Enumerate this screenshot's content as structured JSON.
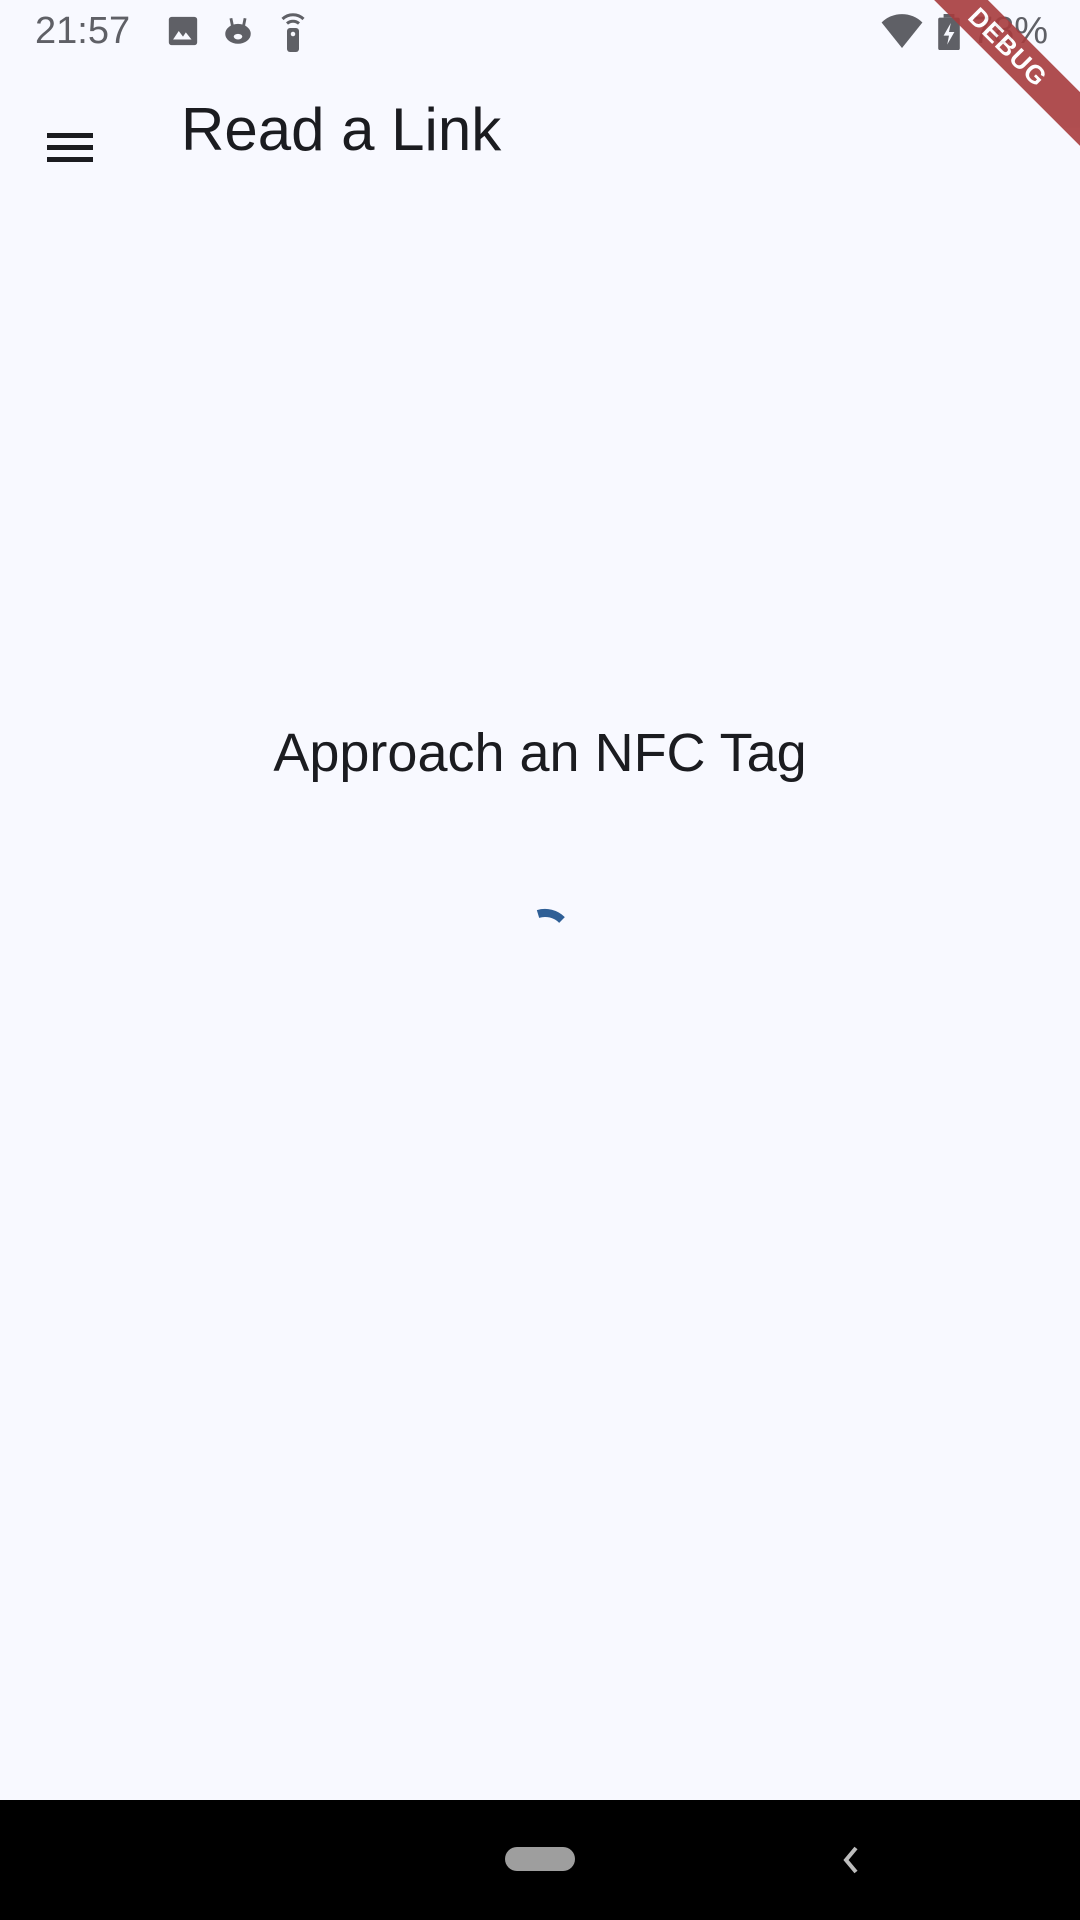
{
  "status_bar": {
    "time": "21:57",
    "battery": "78%",
    "icons": [
      "image-icon",
      "android-debug-icon",
      "nfc-remote-icon",
      "wifi-icon",
      "battery-charging-icon"
    ]
  },
  "app_bar": {
    "title": "Read a Link",
    "menu_icon": "hamburger-menu-icon"
  },
  "main": {
    "message": "Approach an NFC Tag",
    "spinner_color": "#2f5f96"
  },
  "debug_banner": "DEBUG",
  "colors": {
    "background": "#f8f9ff",
    "banner": "#a83c3e"
  }
}
